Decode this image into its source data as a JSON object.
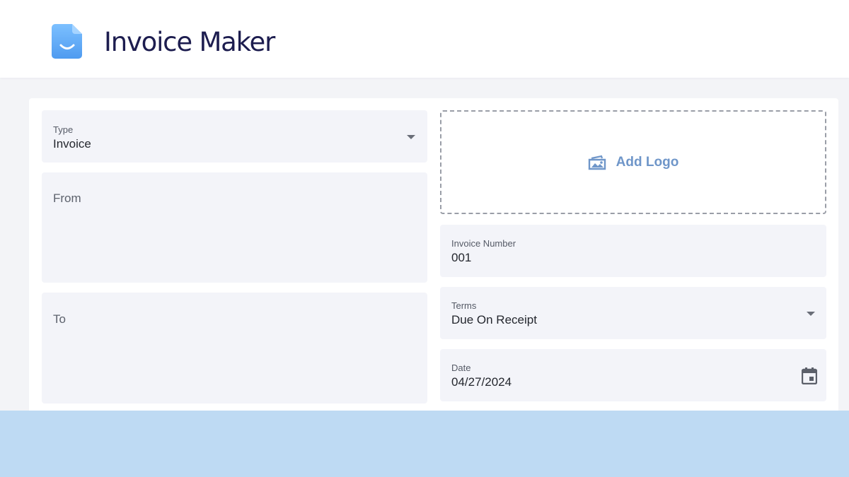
{
  "header": {
    "app_title": "Invoice Maker",
    "logo_icon": "document-smile-icon"
  },
  "form": {
    "type": {
      "label": "Type",
      "value": "Invoice",
      "icon": "caret-down-icon"
    },
    "from": {
      "placeholder": "From"
    },
    "to": {
      "placeholder": "To"
    },
    "logo": {
      "label": "Add Logo",
      "icon": "image-upload-icon"
    },
    "invoice_number": {
      "label": "Invoice Number",
      "value": "001"
    },
    "terms": {
      "label": "Terms",
      "value": "Due On Receipt",
      "icon": "caret-down-icon"
    },
    "date": {
      "label": "Date",
      "value": "04/27/2024",
      "icon": "calendar-icon"
    }
  },
  "colors": {
    "brand_text": "#1d1d4f",
    "accent_blue": "#6f96c9",
    "field_bg": "#f3f4f9",
    "bottom_band": "#bedaf3"
  }
}
